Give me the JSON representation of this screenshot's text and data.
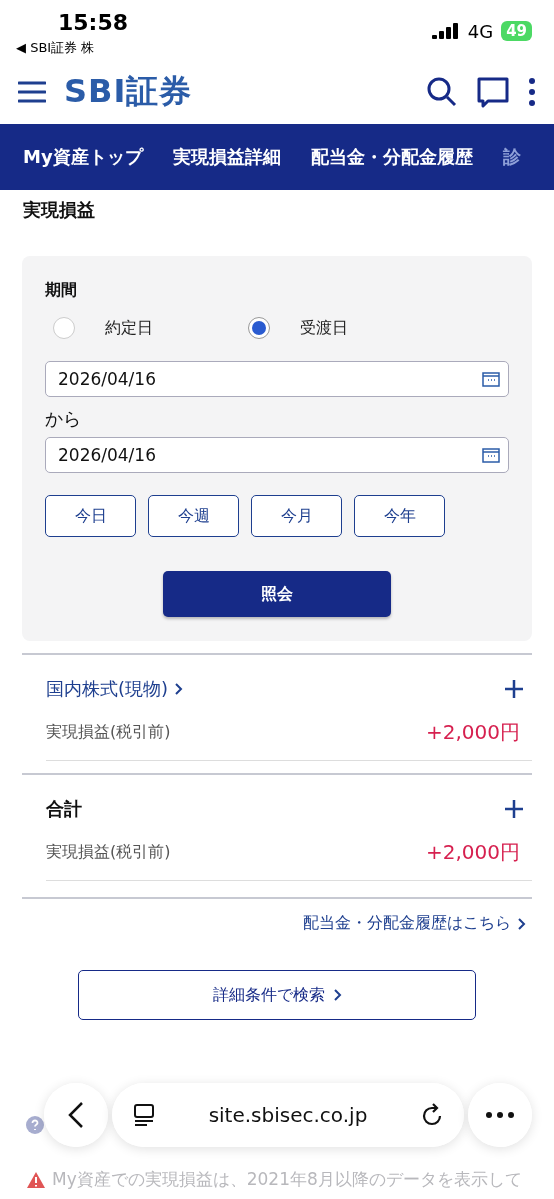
{
  "status_bar": {
    "time": "15:58",
    "back_label": "◀ SBI証券 株",
    "network": "4G",
    "battery": "49"
  },
  "header": {
    "logo": "SBI証券"
  },
  "nav_tabs": [
    "My資産トップ",
    "実現損益詳細",
    "配当金・分配金履歴",
    "診"
  ],
  "page_title": "実現損益",
  "filter": {
    "period_label": "期間",
    "radios": [
      {
        "label": "約定日",
        "selected": false
      },
      {
        "label": "受渡日",
        "selected": true
      }
    ],
    "date_from": "2026/04/16",
    "between": "から",
    "date_to": "2026/04/16",
    "quick_buttons": [
      "今日",
      "今週",
      "今月",
      "今年"
    ],
    "submit": "照会"
  },
  "sections": [
    {
      "kind": "link",
      "title": "国内株式(現物)",
      "row_label": "実現損益(税引前)",
      "row_value": "+2,000円"
    },
    {
      "kind": "total",
      "title": "合計",
      "row_label": "実現損益(税引前)",
      "row_value": "+2,000円"
    }
  ],
  "dividend_link": "配当金・分配金履歴はこちら",
  "search_button": "詳細条件で検索",
  "warning_note": "My資産での実現損益は、2021年8月以降のデータを表示して",
  "browser": {
    "url": "site.sbisec.co.jp"
  }
}
